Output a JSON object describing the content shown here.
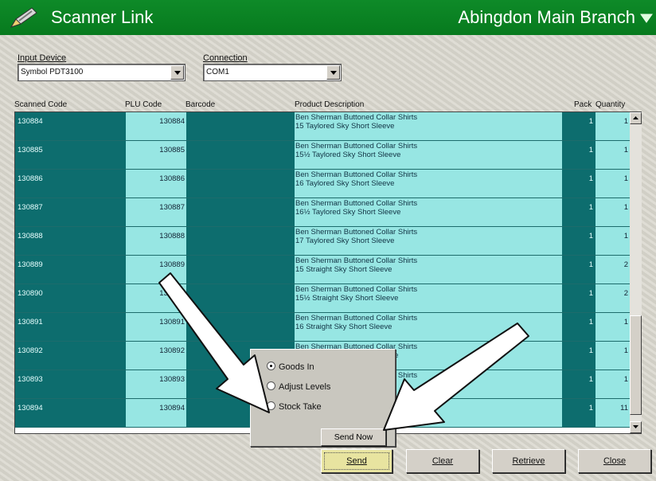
{
  "titlebar": {
    "app_title": "Scanner Link",
    "branch": "Abingdon Main Branch"
  },
  "input_device": {
    "label": "Input Device",
    "value": "Symbol PDT3100"
  },
  "connection": {
    "label": "Connection",
    "value": "COM1"
  },
  "columns": [
    "Scanned Code",
    "PLU Code",
    "Barcode",
    "Product Description",
    "Pack",
    "Quantity"
  ],
  "rows": [
    {
      "code": "130884",
      "plu": "130884",
      "desc1": "Ben Sherman Buttoned Collar Shirts",
      "desc2": "15 Taylored  Sky Short Sleeve",
      "pack": "1",
      "qty": "1"
    },
    {
      "code": "130885",
      "plu": "130885",
      "desc1": "Ben Sherman Buttoned Collar Shirts",
      "desc2": "15½ Taylored  Sky Short Sleeve",
      "pack": "1",
      "qty": "1"
    },
    {
      "code": "130886",
      "plu": "130886",
      "desc1": "Ben Sherman Buttoned Collar Shirts",
      "desc2": "16 Taylored  Sky Short Sleeve",
      "pack": "1",
      "qty": "1"
    },
    {
      "code": "130887",
      "plu": "130887",
      "desc1": "Ben Sherman Buttoned Collar Shirts",
      "desc2": "16½ Taylored  Sky Short Sleeve",
      "pack": "1",
      "qty": "1"
    },
    {
      "code": "130888",
      "plu": "130888",
      "desc1": "Ben Sherman Buttoned Collar Shirts",
      "desc2": "17 Taylored  Sky Short Sleeve",
      "pack": "1",
      "qty": "1"
    },
    {
      "code": "130889",
      "plu": "130889",
      "desc1": "Ben Sherman Buttoned Collar Shirts",
      "desc2": "15 Straight  Sky Short Sleeve",
      "pack": "1",
      "qty": "2"
    },
    {
      "code": "130890",
      "plu": "130890",
      "desc1": "Ben Sherman Buttoned Collar Shirts",
      "desc2": "15½ Straight  Sky Short Sleeve",
      "pack": "1",
      "qty": "2"
    },
    {
      "code": "130891",
      "plu": "130891",
      "desc1": "Ben Sherman Buttoned Collar Shirts",
      "desc2": "16 Straight  Sky Short Sleeve",
      "pack": "1",
      "qty": "1"
    },
    {
      "code": "130892",
      "plu": "130892",
      "desc1": "Ben Sherman Buttoned Collar Shirts",
      "desc2": "16½ Straight  Sky Short Sleeve",
      "pack": "1",
      "qty": "1"
    },
    {
      "code": "130893",
      "plu": "130893",
      "desc1": "Ben Sherman Buttoned Collar Shirts",
      "desc2": "17 Straight  Sky Short Sleeve",
      "pack": "1",
      "qty": "1"
    },
    {
      "code": "130894",
      "plu": "130894",
      "desc1": "Ben Sherman Buttoned Collar Shirts",
      "desc2": "17½ Straight  Sky Short Sleeve",
      "pack": "1",
      "qty": "11"
    }
  ],
  "popup": {
    "options": [
      "Goods In",
      "Adjust Levels",
      "Stock Take"
    ],
    "selected": "Goods In",
    "send_now": "Send Now"
  },
  "buttons": {
    "send": "Send",
    "clear": "Clear",
    "retrieve": "Retrieve",
    "close": "Close"
  },
  "colors": {
    "titlebar": "#0a8424",
    "dark_teal": "#0d6d6e",
    "light_cyan": "#97e6e3"
  }
}
